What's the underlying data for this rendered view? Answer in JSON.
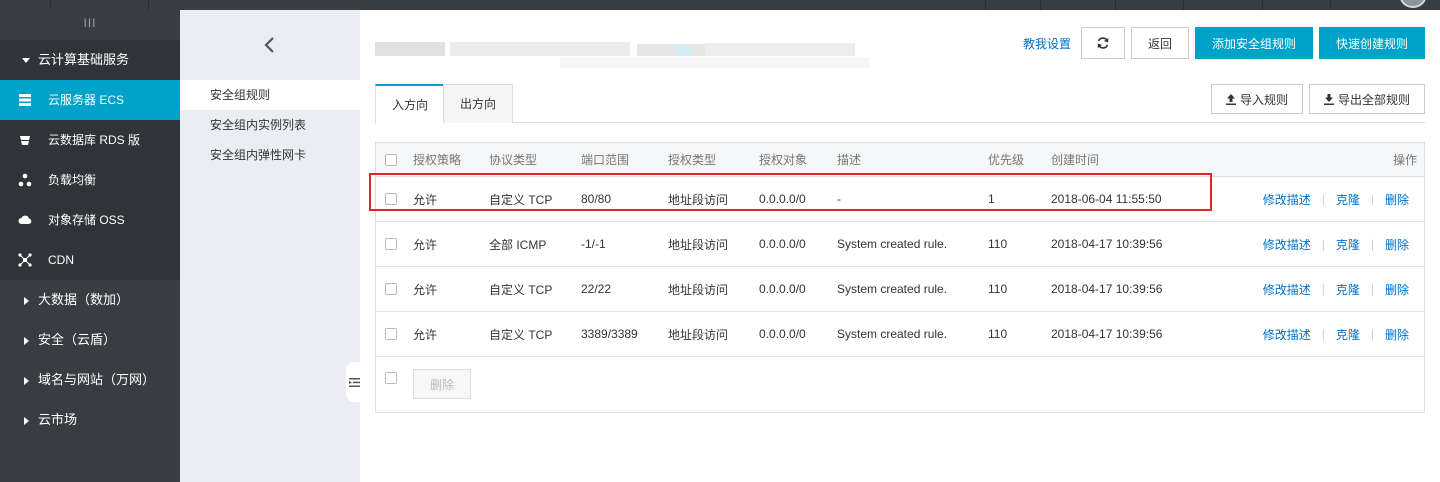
{
  "sidebar": {
    "toggle_label": "III",
    "group_label": "云计算基础服务",
    "items": [
      {
        "label": "云服务器 ECS",
        "icon": "server-icon",
        "active": true
      },
      {
        "label": "云数据库 RDS 版",
        "icon": "database-icon",
        "active": false
      },
      {
        "label": "负载均衡",
        "icon": "load-balancer-icon",
        "active": false
      },
      {
        "label": "对象存储 OSS",
        "icon": "cloud-storage-icon",
        "active": false
      },
      {
        "label": "CDN",
        "icon": "cdn-icon",
        "active": false
      }
    ],
    "categories": [
      "大数据（数加）",
      "安全（云盾）",
      "域名与网站（万网）",
      "云市场"
    ]
  },
  "subnav": {
    "items": [
      "安全组规则",
      "安全组内实例列表",
      "安全组内弹性网卡"
    ]
  },
  "header": {
    "help_link": "教我设置",
    "back_label": "返回",
    "add_rule_label": "添加安全组规则",
    "quick_create_label": "快速创建规则"
  },
  "tabs": {
    "inbound": "入方向",
    "outbound": "出方向",
    "import_label": "导入规则",
    "export_label": "导出全部规则"
  },
  "table": {
    "columns": [
      "授权策略",
      "协议类型",
      "端口范围",
      "授权类型",
      "授权对象",
      "描述",
      "优先级",
      "创建时间",
      "操作"
    ],
    "rows": [
      {
        "policy": "允许",
        "protocol": "自定义 TCP",
        "port": "80/80",
        "auth_type": "地址段访问",
        "target": "0.0.0.0/0",
        "desc": "-",
        "priority": "1",
        "created": "2018-06-04 11:55:50"
      },
      {
        "policy": "允许",
        "protocol": "全部 ICMP",
        "port": "-1/-1",
        "auth_type": "地址段访问",
        "target": "0.0.0.0/0",
        "desc": "System created rule.",
        "priority": "110",
        "created": "2018-04-17 10:39:56"
      },
      {
        "policy": "允许",
        "protocol": "自定义 TCP",
        "port": "22/22",
        "auth_type": "地址段访问",
        "target": "0.0.0.0/0",
        "desc": "System created rule.",
        "priority": "110",
        "created": "2018-04-17 10:39:56"
      },
      {
        "policy": "允许",
        "protocol": "自定义 TCP",
        "port": "3389/3389",
        "auth_type": "地址段访问",
        "target": "0.0.0.0/0",
        "desc": "System created rule.",
        "priority": "110",
        "created": "2018-04-17 10:39:56"
      }
    ],
    "actions": {
      "edit": "修改描述",
      "clone": "克隆",
      "delete": "删除"
    },
    "bulk_delete": "删除"
  },
  "colors": {
    "accent": "#00a2ca",
    "sidebar_bg": "#373d41",
    "highlight": "#e0252b",
    "link": "#0070cc"
  }
}
